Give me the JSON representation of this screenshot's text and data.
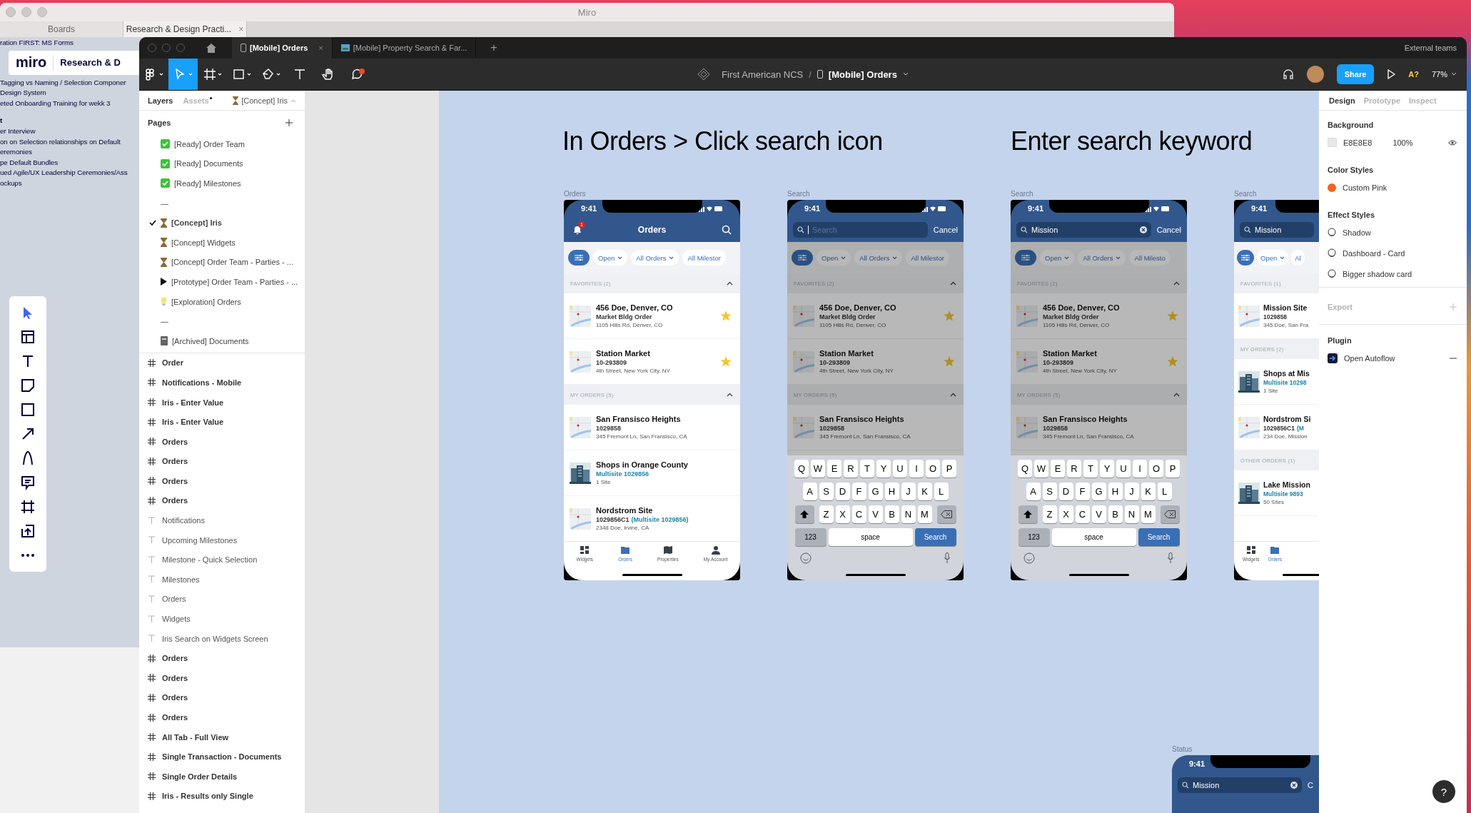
{
  "miro": {
    "title": "Miro",
    "tabs": [
      {
        "label": "Boards",
        "selected": false
      },
      {
        "label": "Research & Design Practi...",
        "selected": true
      }
    ],
    "close": "×",
    "board_lines_top": [
      {
        "text": "ration FIRST: MS Forms",
        "bold": false
      }
    ],
    "board_header": {
      "logo": "miro",
      "title": "Research & D"
    },
    "board_lines": [
      {
        "text": "Tagging vs Naming / Selection Componer",
        "bold": false
      },
      {
        "text": "Design System",
        "bold": false
      },
      {
        "text": "eted Onboarding Training for wekk 3",
        "bold": false
      },
      {
        "text": "t",
        "bold": true
      },
      {
        "text": "er Interview",
        "bold": false
      },
      {
        "text": "on on Selection relationships on Default",
        "bold": false
      },
      {
        "text": "eremonies",
        "bold": false
      },
      {
        "text": "pe Default Bundles",
        "bold": false
      },
      {
        "text": "ued Agile/UX Leadership Ceremonies/Ass",
        "bold": false
      },
      {
        "text": "ockups",
        "bold": false
      }
    ],
    "tools": [
      {
        "kind": "select",
        "selected": true
      },
      {
        "kind": "templates",
        "selected": false
      },
      {
        "kind": "text",
        "selected": false
      },
      {
        "kind": "sticky",
        "selected": false
      },
      {
        "kind": "shape",
        "selected": false
      },
      {
        "kind": "arrow",
        "selected": false
      },
      {
        "kind": "pen",
        "selected": false
      },
      {
        "kind": "comment",
        "selected": false
      },
      {
        "kind": "frame",
        "selected": false
      },
      {
        "kind": "upload",
        "selected": false
      },
      {
        "kind": "more",
        "selected": false
      }
    ]
  },
  "figma": {
    "tabs": [
      {
        "label": "[Mobile] Orders",
        "selected": true,
        "close": "×"
      },
      {
        "label": "[Mobile] Property Search & Far...",
        "selected": false
      }
    ],
    "new_tab": "+",
    "teams": "External teams",
    "tools": [
      {
        "kind": "menu",
        "selected": false
      },
      {
        "kind": "move",
        "selected": true
      },
      {
        "kind": "frame",
        "selected": false
      },
      {
        "kind": "shape",
        "selected": false
      },
      {
        "kind": "pen",
        "selected": false
      },
      {
        "kind": "text",
        "selected": false
      },
      {
        "kind": "hand",
        "selected": false
      },
      {
        "kind": "comment",
        "selected": false
      }
    ],
    "breadcrumb": {
      "team": "First American NCS",
      "separator": "/",
      "file": "[Mobile] Orders"
    },
    "share": "Share",
    "font_warning": "A?",
    "zoom": "77%",
    "left_panel": {
      "tabs": [
        {
          "label": "Layers",
          "selected": true
        },
        {
          "label": "Assets",
          "selected": false
        }
      ],
      "current_page": "[Concept] Iris",
      "pages_title": "Pages",
      "pages": [
        {
          "label": "[Ready] Order Team",
          "kind": "ready",
          "selected": false
        },
        {
          "label": "[Ready] Documents",
          "kind": "ready",
          "selected": false
        },
        {
          "label": "[Ready] Milestones",
          "kind": "ready",
          "selected": false
        },
        {
          "label": "—",
          "kind": "divider",
          "selected": false
        },
        {
          "label": "[Concept] Iris",
          "kind": "concept",
          "selected": true
        },
        {
          "label": "[Concept] Widgets",
          "kind": "concept",
          "selected": false
        },
        {
          "label": "[Concept]  Order Team - Parties - ...",
          "kind": "concept",
          "selected": false
        },
        {
          "label": "[Prototype] Order Team - Parties - ...",
          "kind": "prototype",
          "selected": false
        },
        {
          "label": "[Exploration] Orders",
          "kind": "exploration",
          "selected": false
        },
        {
          "label": "—",
          "kind": "divider",
          "selected": false
        },
        {
          "label": "[Archived] Documents",
          "kind": "archived",
          "selected": false
        }
      ],
      "layers": [
        {
          "label": "Order",
          "kind": "frame"
        },
        {
          "label": "Notifications - Mobile",
          "kind": "frame"
        },
        {
          "label": "Iris - Enter Value",
          "kind": "frame"
        },
        {
          "label": "Iris - Enter Value",
          "kind": "frame"
        },
        {
          "label": "Orders",
          "kind": "frame"
        },
        {
          "label": "Orders",
          "kind": "frame"
        },
        {
          "label": "Orders",
          "kind": "frame"
        },
        {
          "label": "Orders",
          "kind": "frame"
        },
        {
          "label": "Notifications",
          "kind": "text"
        },
        {
          "label": "Upcoming Milestones",
          "kind": "text"
        },
        {
          "label": "Milestone - Quick Selection",
          "kind": "text"
        },
        {
          "label": "Milestones",
          "kind": "text"
        },
        {
          "label": "Orders",
          "kind": "text"
        },
        {
          "label": "Widgets",
          "kind": "text"
        },
        {
          "label": "Iris Search on Widgets Screen",
          "kind": "text"
        },
        {
          "label": "Orders",
          "kind": "frame"
        },
        {
          "label": "Orders",
          "kind": "frame"
        },
        {
          "label": "Orders",
          "kind": "frame"
        },
        {
          "label": "Orders",
          "kind": "frame"
        },
        {
          "label": "All Tab - Full View",
          "kind": "frame"
        },
        {
          "label": "Single Transaction - Documents",
          "kind": "frame"
        },
        {
          "label": "Single Order Details",
          "kind": "frame"
        },
        {
          "label": "Iris - Results only Single",
          "kind": "frame"
        }
      ]
    },
    "canvas": {
      "headings": [
        "In Orders > Click search icon",
        "Enter search keyword"
      ],
      "phones": [
        {
          "label": "Orders",
          "time": "9:41",
          "clipped": false,
          "dimmed": false,
          "header": {
            "kind": "title",
            "title": "Orders",
            "badge": "1"
          },
          "chips": [
            {
              "label": "Open",
              "caret": true
            },
            {
              "label": "All Orders",
              "caret": true
            },
            {
              "label": "All Milestor",
              "caret": false
            }
          ],
          "sections": [
            {
              "title": "FAVORITES (2)",
              "items": [
                {
                  "title": "456 Doe, Denver, CO",
                  "code": "Market Bldg Order",
                  "address": "1105 Hills Rd, Denver, CO",
                  "favorite": true
                },
                {
                  "title": "Station Market",
                  "code": "10-293809",
                  "address": "4th Street, New York City, NY",
                  "favorite": true
                }
              ]
            },
            {
              "title": "MY ORDERS (5)",
              "items": [
                {
                  "title": "San Fransisco Heights",
                  "code": "1029858",
                  "address": "345 Fremont Ln, San Fransisco, CA",
                  "favorite": false
                },
                {
                  "title": "Shops in Orange County",
                  "link": "Multisite 1029856",
                  "address": "1 Site",
                  "favorite": false
                },
                {
                  "title": "Nordstrom Site",
                  "code": "1029856C1",
                  "link": "(Multisite 1029856)",
                  "address": "2348 Doe, Irvine, CA",
                  "favorite": false
                }
              ]
            }
          ],
          "tabs": [
            {
              "label": "Widgets",
              "kind": "widgets",
              "selected": false
            },
            {
              "label": "Orders",
              "kind": "orders",
              "selected": true
            },
            {
              "label": "Properties",
              "kind": "properties",
              "selected": false
            },
            {
              "label": "My Account",
              "kind": "account",
              "selected": false
            }
          ]
        },
        {
          "label": "Search",
          "time": "9:41",
          "clipped": false,
          "dimmed": true,
          "header": {
            "kind": "search",
            "placeholder": "Search",
            "cancel": "Cancel",
            "clear": false
          },
          "chips": [
            {
              "label": "Open",
              "caret": true
            },
            {
              "label": "All Orders",
              "caret": true
            },
            {
              "label": "All Milestor",
              "caret": false
            }
          ],
          "sections": [
            {
              "title": "FAVORITES (2)",
              "items": [
                {
                  "title": "456 Doe, Denver, CO",
                  "code": "Market Bldg Order",
                  "address": "1105 Hills Rd, Denver, CO",
                  "favorite": true
                },
                {
                  "title": "Station Market",
                  "code": "10-293809",
                  "address": "4th Street, New York City, NY",
                  "favorite": true
                }
              ]
            },
            {
              "title": "MY ORDERS (5)",
              "items": [
                {
                  "title": "San Fransisco Heights",
                  "code": "1029858",
                  "address": "345 Fremont Ln, San Fransisco, CA",
                  "favorite": false
                }
              ]
            }
          ],
          "keyboard": {
            "rows": [
              [
                "Q",
                "W",
                "E",
                "R",
                "T",
                "Y",
                "U",
                "I",
                "O",
                "P"
              ],
              [
                "A",
                "S",
                "D",
                "F",
                "G",
                "H",
                "J",
                "K",
                "L"
              ],
              [
                "Z",
                "X",
                "C",
                "V",
                "B",
                "N",
                "M"
              ]
            ],
            "numbers": "123",
            "space": "space",
            "action": "Search"
          }
        },
        {
          "label": "Search",
          "time": "9:41",
          "clipped": false,
          "dimmed": true,
          "header": {
            "kind": "search",
            "value": "Mission",
            "cancel": "Cancel",
            "clear": true
          },
          "chips": [
            {
              "label": "Open",
              "caret": true
            },
            {
              "label": "All Orders",
              "caret": true
            },
            {
              "label": "All Milesto",
              "caret": false
            }
          ],
          "sections": [
            {
              "title": "FAVORITES (2)",
              "items": [
                {
                  "title": "456 Doe, Denver, CO",
                  "code": "Market Bldg Order",
                  "address": "1105 Hills Rd, Denver, CO",
                  "favorite": true
                },
                {
                  "title": "Station Market",
                  "code": "10-293809",
                  "address": "4th Street, New York City, NY",
                  "favorite": true
                }
              ]
            },
            {
              "title": "MY ORDERS (5)",
              "items": [
                {
                  "title": "San Fransisco Heights",
                  "code": "1029858",
                  "address": "345 Fremont Ln, San Fransisco, CA",
                  "favorite": false
                }
              ]
            }
          ],
          "keyboard": {
            "rows": [
              [
                "Q",
                "W",
                "E",
                "R",
                "T",
                "Y",
                "U",
                "I",
                "O",
                "P"
              ],
              [
                "A",
                "S",
                "D",
                "F",
                "G",
                "H",
                "J",
                "K",
                "L"
              ],
              [
                "Z",
                "X",
                "C",
                "V",
                "B",
                "N",
                "M"
              ]
            ],
            "numbers": "123",
            "space": "space",
            "action": "Search"
          }
        },
        {
          "label": "Search",
          "time": "9:41",
          "clipped": true,
          "dimmed": false,
          "header": {
            "kind": "search",
            "value": "Mission",
            "clear": false
          },
          "chips": [
            {
              "label": "Open",
              "caret": true
            },
            {
              "label": "Al",
              "caret": false
            }
          ],
          "sections": [
            {
              "title": "FAVORITES (1)",
              "items": [
                {
                  "title": "Mission Site",
                  "code": "1029858",
                  "address": "345 Doe, San Fra",
                  "favorite": false
                }
              ]
            },
            {
              "title": "MY ORDERS (2)",
              "items": [
                {
                  "title": "Shops at Mis",
                  "link": "Multisite 10298",
                  "address": "1 Site",
                  "favorite": false
                },
                {
                  "title": "Nordstrom Si",
                  "code": "1029856C1",
                  "link": "(M",
                  "address": "234 Doe, Mission",
                  "favorite": false
                }
              ]
            },
            {
              "title": "OTHER ORDERS (1)",
              "items": [
                {
                  "title": "Lake Mission",
                  "link": "Multisite 9893",
                  "address": "50 Sites",
                  "favorite": false
                }
              ]
            }
          ],
          "tabs": [
            {
              "label": "Widgets",
              "kind": "widgets",
              "selected": false
            },
            {
              "label": "Orders",
              "kind": "orders",
              "selected": true
            }
          ]
        }
      ],
      "status_frame": {
        "label": "Status",
        "time": "9:41",
        "search_value": "Mission",
        "cancel": "C"
      }
    },
    "right_panel": {
      "tabs": [
        {
          "label": "Design",
          "selected": true
        },
        {
          "label": "Prototype",
          "selected": false
        },
        {
          "label": "Inspect",
          "selected": false
        }
      ],
      "background": {
        "title": "Background",
        "hex": "E8E8E8",
        "opacity": "100%"
      },
      "color_styles": {
        "title": "Color Styles",
        "items": [
          {
            "name": "Custom Pink",
            "color": "#f26522"
          }
        ]
      },
      "effect_styles": {
        "title": "Effect Styles",
        "items": [
          "Shadow",
          "Dashboard - Card",
          "Bigger shadow card"
        ]
      },
      "export": {
        "title": "Export"
      },
      "plugin": {
        "title": "Plugin",
        "items": [
          "Open Autoflow"
        ]
      },
      "help": "?"
    }
  }
}
